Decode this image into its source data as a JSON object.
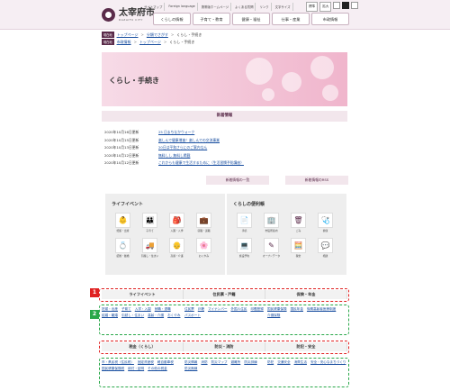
{
  "header": {
    "logo_name": "太宰府市",
    "logo_sub": "DAZAIFU CITY",
    "utils": [
      "サイトマップ",
      "Foreign language",
      "携帯版ホームページ",
      "よくある質問",
      "リンク",
      "文字サイズ"
    ],
    "font_small": "標準",
    "font_large": "拡大",
    "nav": [
      "くらしの情報",
      "子育て・教育",
      "健康・福祉",
      "仕事・産業",
      "市政情報"
    ]
  },
  "crumbs1": {
    "tag": "現在地",
    "items": [
      "トップページ",
      "分類でさがす",
      "くらし・手続き"
    ]
  },
  "crumbs2": {
    "tag": "現在地",
    "items": [
      "市政情報",
      "トップページ",
      "くらし・手続き"
    ]
  },
  "hero": {
    "title": "くらし・手続き"
  },
  "news": {
    "heading": "新着情報",
    "items": [
      {
        "date": "2020年10月16日更新",
        "title": "25 日まちなかウォーク"
      },
      {
        "date": "2020年10月15日更新",
        "title": "楽しんで健康增進！楽しんでの交流事業"
      },
      {
        "date": "2020年10月13日更新",
        "title": "20日は平和さらにのご案内なん"
      },
      {
        "date": "2020年10月12日更新",
        "title": "無料しし 無料し掲載"
      },
      {
        "date": "2020年10月12日更新",
        "title": "これからも健康で生活するために（生活習慣予防講座）"
      }
    ],
    "list_button": "新着情報の一覧",
    "rss_button": "新着情報のRSS"
  },
  "life": {
    "title": "ライフイベント",
    "items": [
      {
        "label": "妊娠・出産",
        "icon": "baby-icon",
        "glyph": "👶"
      },
      {
        "label": "子育て",
        "icon": "parent-icon",
        "glyph": "👪"
      },
      {
        "label": "入園・入学",
        "icon": "school-icon",
        "glyph": "🎒"
      },
      {
        "label": "就職・退職",
        "icon": "briefcase-icon",
        "glyph": "💼"
      },
      {
        "label": "結婚・離婚",
        "icon": "ring-icon",
        "glyph": "💍"
      },
      {
        "label": "引越し・住まい",
        "icon": "truck-icon",
        "glyph": "🚚"
      },
      {
        "label": "高齢・介護",
        "icon": "elderly-icon",
        "glyph": "👴"
      },
      {
        "label": "おくやみ",
        "icon": "flower-icon",
        "glyph": "🌸"
      }
    ]
  },
  "convenience": {
    "title": "くらしの便利帳",
    "items": [
      {
        "label": "手続",
        "icon": "document-icon",
        "glyph": "📄"
      },
      {
        "label": "市役所案内",
        "icon": "building-icon",
        "glyph": "🏢"
      },
      {
        "label": "ごみ",
        "icon": "trash-icon",
        "glyph": "🗑"
      },
      {
        "label": "健康",
        "icon": "stethoscope-icon",
        "glyph": "🩺"
      },
      {
        "label": "施設予約",
        "icon": "laptop-icon",
        "glyph": "💻"
      },
      {
        "label": "オープンデータ",
        "icon": "pencil-icon",
        "glyph": "✎"
      },
      {
        "label": "税金",
        "icon": "calculator-icon",
        "glyph": "🧮"
      },
      {
        "label": "相談",
        "icon": "chat-icon",
        "glyph": "💬"
      }
    ]
  },
  "categories1": {
    "headers": [
      "ライフイベント",
      "住民票・戸籍",
      "保険・年金"
    ],
    "col1": [
      "妊娠・出産",
      "子育て",
      "入学・入園",
      "就職・退職",
      "結婚・離婚",
      "引越し・住まい",
      "高齢・介護",
      "おくやみ"
    ],
    "col2": [
      "住民票",
      "戸籍",
      "マイナンバー",
      "外国人住民",
      "印鑑登録",
      "パスポート"
    ],
    "col3": [
      "国民健康保険",
      "国民年金",
      "後期高齢者医療制度",
      "介護保険"
    ]
  },
  "categories2": {
    "headers": [
      "税金（くらし）",
      "防災・消防",
      "防犯・安全"
    ],
    "col1": [
      "市・県民税（住民税）",
      "固定資産税",
      "軽自動車税",
      "国民健康保険税",
      "納付・証明",
      "その他の税金"
    ],
    "col2": [
      "防災情報",
      "消防",
      "防災マップ",
      "避難所",
      "防災訓練",
      "防災無線"
    ],
    "col3": [
      "防犯",
      "交通安全",
      "消費生活",
      "安全・安心なまちづくり"
    ]
  },
  "badges": {
    "red": "1",
    "green": "2"
  }
}
